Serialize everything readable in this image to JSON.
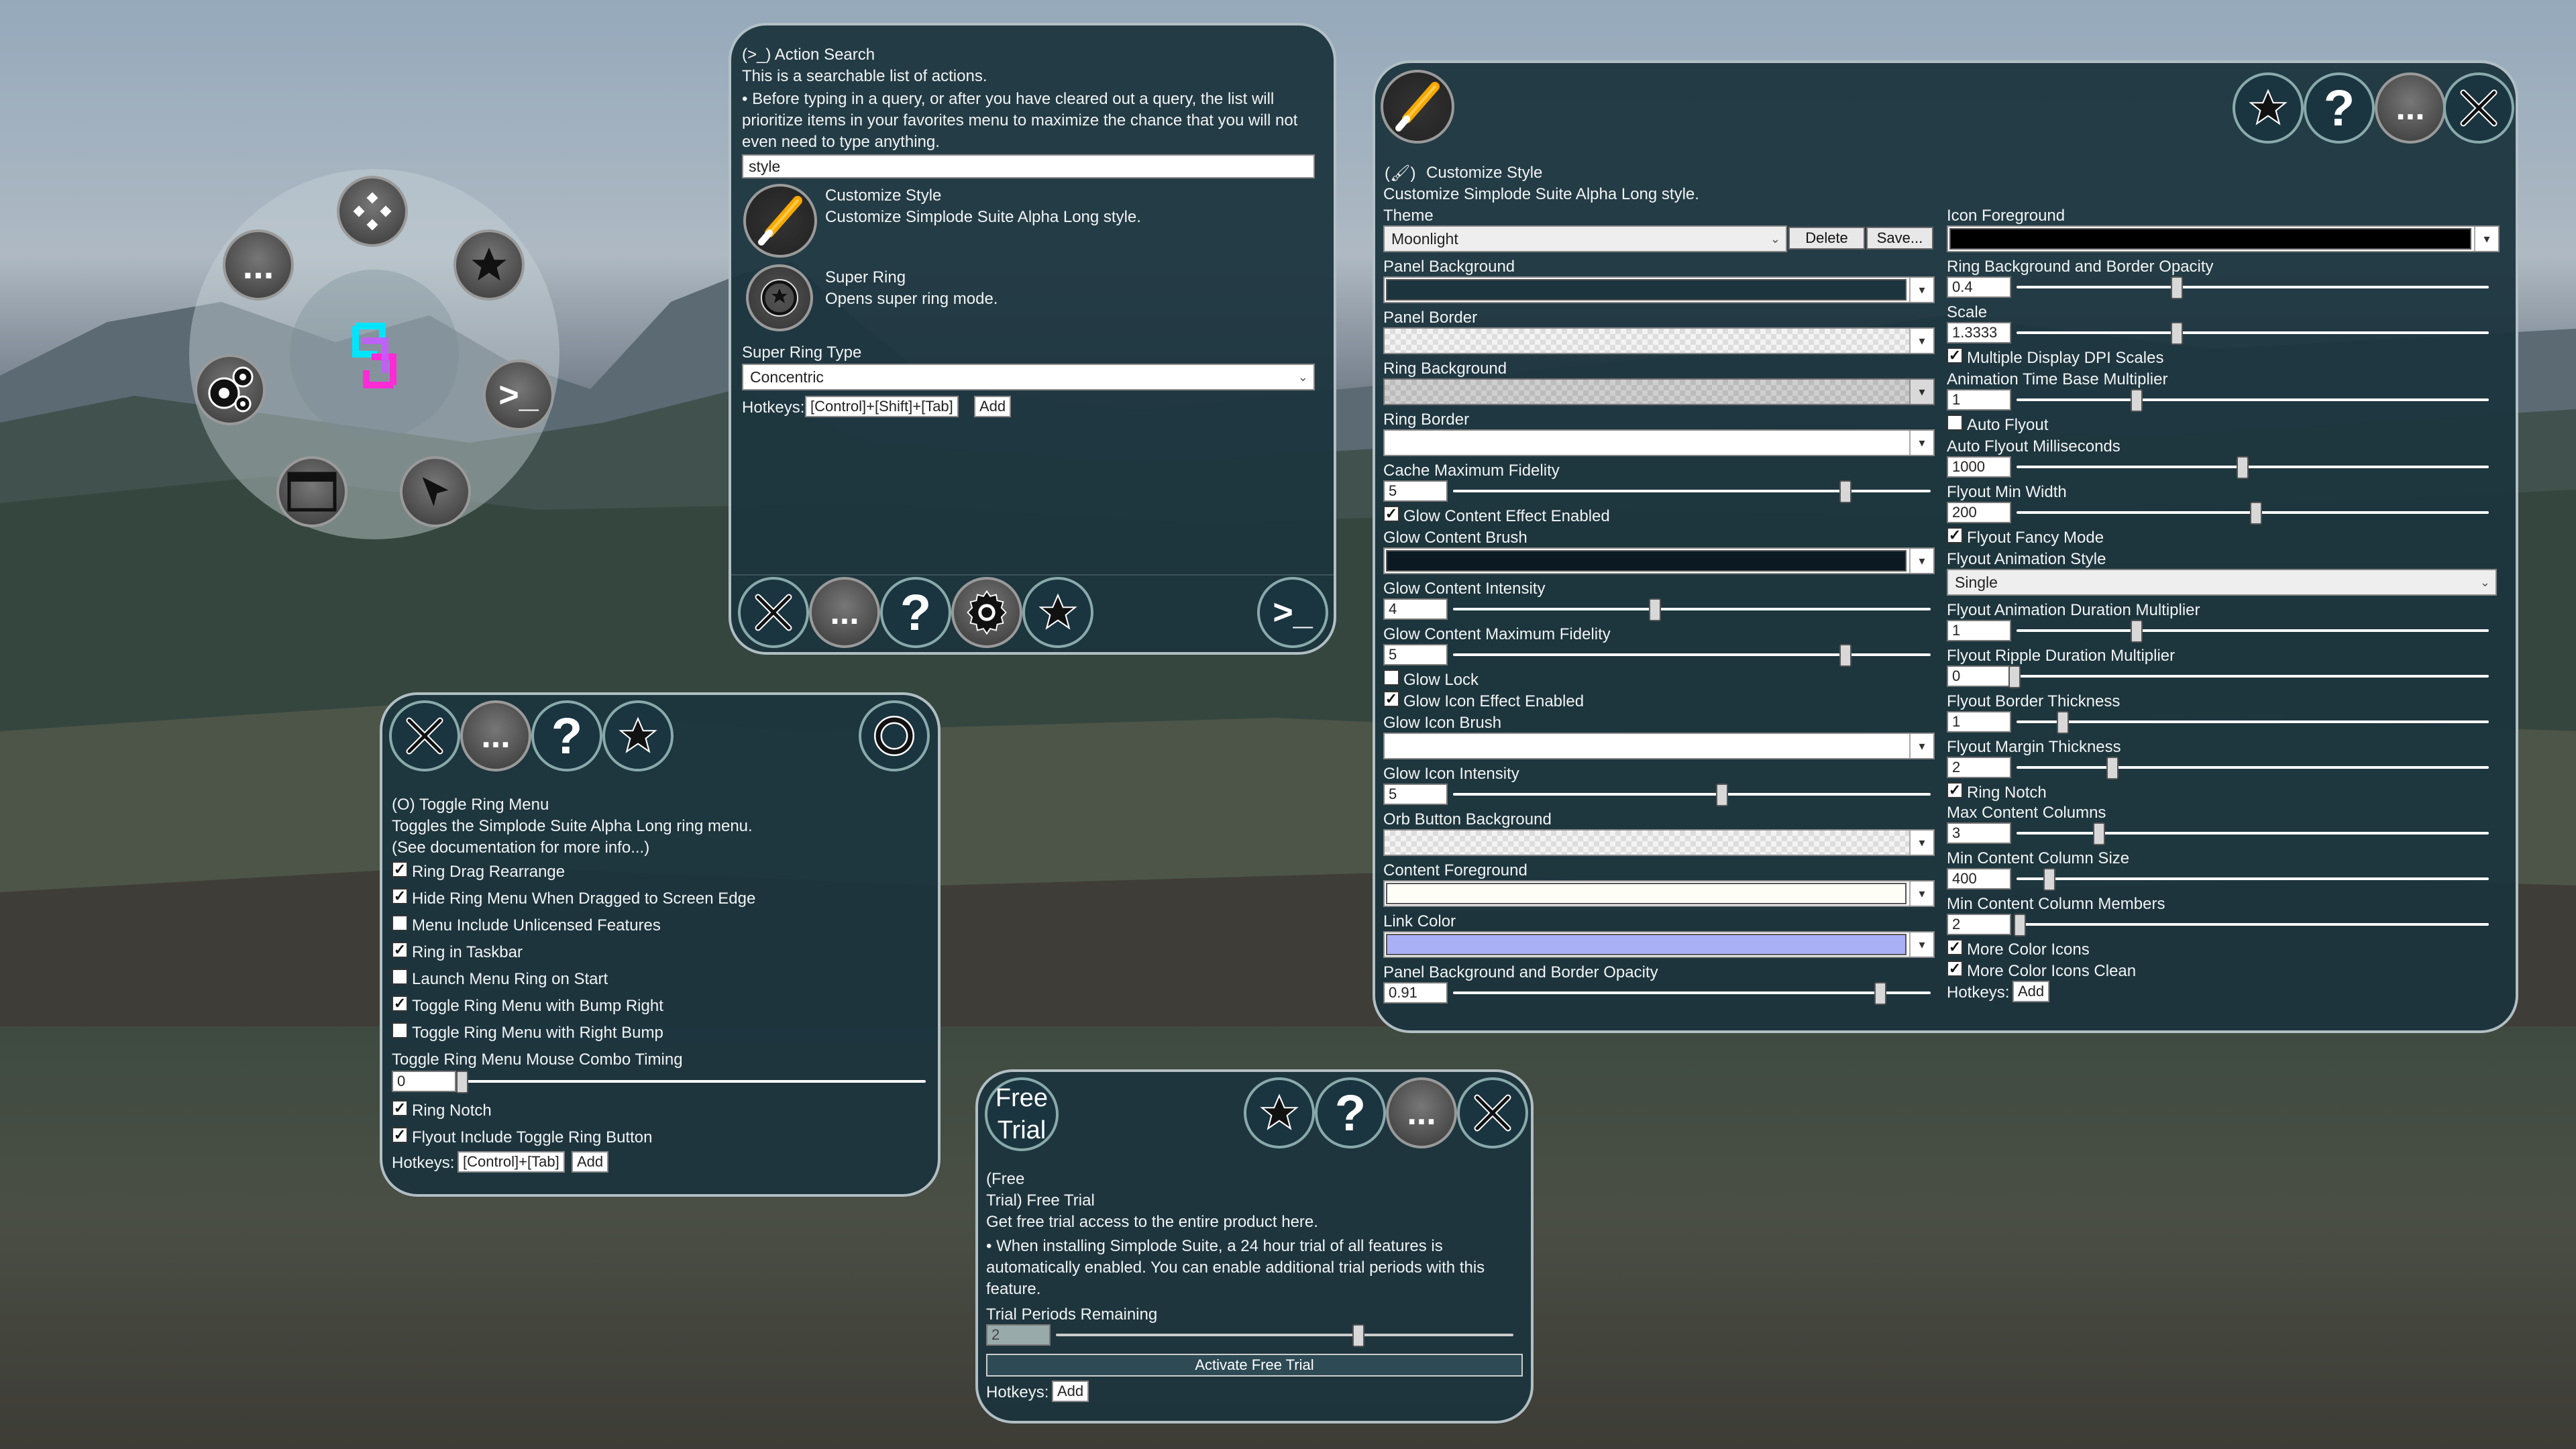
{
  "ring": {
    "more": "...",
    "console": ">_"
  },
  "action_search": {
    "title": "(>_)  Action Search",
    "desc1": "This is a searchable list of actions.",
    "desc2": "• Before typing in a query, or after you have cleared out a query, the list will",
    "desc3": "prioritize items in your favorites menu to maximize the chance that you will not",
    "desc4": "even need to type anything.",
    "query": "style",
    "results": [
      {
        "title": "Customize Style",
        "subtitle": "Customize Simplode Suite Alpha Long style."
      },
      {
        "title": "Super Ring",
        "subtitle": "Opens super ring mode."
      }
    ],
    "super_ring_type_label": "Super Ring Type",
    "super_ring_type": "Concentric",
    "hotkeys_label": "Hotkeys:",
    "hotkey": "[Control]+[Shift]+[Tab]",
    "add": "Add",
    "more": "...",
    "help": "?",
    "console": ">_"
  },
  "toggle_ring": {
    "title": "(O)  Toggle Ring Menu",
    "desc1": "Toggles the Simplode Suite Alpha Long ring menu.",
    "desc2": "(See documentation for more info...)",
    "options": [
      {
        "label": "Ring Drag Rearrange",
        "checked": true
      },
      {
        "label": "Hide Ring Menu When Dragged to Screen Edge",
        "checked": true
      },
      {
        "label": "Menu Include Unlicensed Features",
        "checked": false
      },
      {
        "label": "Ring in Taskbar",
        "checked": true
      },
      {
        "label": "Launch Menu Ring on Start",
        "checked": false
      },
      {
        "label": "Toggle Ring Menu with Bump Right",
        "checked": true
      },
      {
        "label": "Toggle Ring Menu with Right Bump",
        "checked": false
      }
    ],
    "timing_label": "Toggle Ring Menu Mouse Combo Timing",
    "timing_value": "0",
    "ring_notch": "Ring Notch",
    "flyout_toggle": "Flyout Include Toggle Ring Button",
    "hotkeys_label": "Hotkeys:",
    "hotkey": "[Control]+[Tab]",
    "add": "Add",
    "more": "...",
    "help": "?"
  },
  "customize": {
    "title": "Customize Style",
    "desc": "Customize Simplode Suite Alpha Long style.",
    "theme_label": "Theme",
    "theme": "Moonlight",
    "delete": "Delete",
    "save": "Save...",
    "panel_background": "Panel Background",
    "panel_border": "Panel Border",
    "ring_background": "Ring Background",
    "ring_border": "Ring Border",
    "cache_max_fidelity": "Cache Maximum Fidelity",
    "cache_max_fidelity_value": "5",
    "glow_content_enabled": "Glow Content Effect Enabled",
    "glow_content_brush": "Glow Content Brush",
    "glow_content_intensity": "Glow Content Intensity",
    "glow_content_intensity_value": "4",
    "glow_content_max_fidelity": "Glow Content Maximum Fidelity",
    "glow_content_max_fidelity_value": "5",
    "glow_lock": "Glow Lock",
    "glow_icon_enabled": "Glow Icon Effect Enabled",
    "glow_icon_brush": "Glow Icon Brush",
    "glow_icon_intensity": "Glow Icon Intensity",
    "glow_icon_intensity_value": "5",
    "orb_button_background": "Orb Button Background",
    "content_foreground": "Content Foreground",
    "link_color": "Link Color",
    "panel_opacity": "Panel Background and Border Opacity",
    "panel_opacity_value": "0.91",
    "icon_foreground": "Icon Foreground",
    "ring_opacity": "Ring Background and Border Opacity",
    "ring_opacity_value": "0.4",
    "scale": "Scale",
    "scale_value": "1.3333",
    "multi_dpi": "Multiple Display DPI Scales",
    "anim_base": "Animation Time Base Multiplier",
    "anim_base_value": "1",
    "auto_flyout": "Auto Flyout",
    "auto_flyout_ms": "Auto Flyout Milliseconds",
    "auto_flyout_ms_value": "1000",
    "flyout_min_width": "Flyout Min Width",
    "flyout_min_width_value": "200",
    "flyout_fancy": "Flyout Fancy Mode",
    "flyout_anim_style": "Flyout Animation Style",
    "flyout_anim_style_value": "Single",
    "flyout_anim_dur": "Flyout Animation Duration Multiplier",
    "flyout_anim_dur_value": "1",
    "flyout_ripple": "Flyout Ripple Duration Multiplier",
    "flyout_ripple_value": "0",
    "flyout_border": "Flyout Border Thickness",
    "flyout_border_value": "1",
    "flyout_margin": "Flyout Margin Thickness",
    "flyout_margin_value": "2",
    "ring_notch": "Ring Notch",
    "max_cols": "Max Content Columns",
    "max_cols_value": "3",
    "min_col_size": "Min Content Column Size",
    "min_col_size_value": "400",
    "min_col_members": "Min Content Column Members",
    "min_col_members_value": "2",
    "more_color_icons": "More Color Icons",
    "more_color_icons_clean": "More Color Icons Clean",
    "hotkeys_label": "Hotkeys:",
    "add": "Add",
    "more": "...",
    "help": "?",
    "colors": {
      "glow_brush": "#0b1a22",
      "icon_fg": "#000000",
      "link": "#a9b0f5"
    }
  },
  "free_trial": {
    "badge_line1": "Free",
    "badge_line2": "Trial",
    "title_line1": "(Free",
    "title_line2": "Trial)  Free Trial",
    "desc": "Get free trial access to the entire product here.",
    "note1": "• When installing Simplode Suite, a 24 hour trial of all features is",
    "note2": "automatically enabled.  You can enable additional trial periods with this",
    "note3": "feature.",
    "periods_label": "Trial Periods Remaining",
    "periods_value": "2",
    "activate": "Activate Free Trial",
    "hotkeys_label": "Hotkeys:",
    "add": "Add",
    "more": "...",
    "help": "?"
  }
}
